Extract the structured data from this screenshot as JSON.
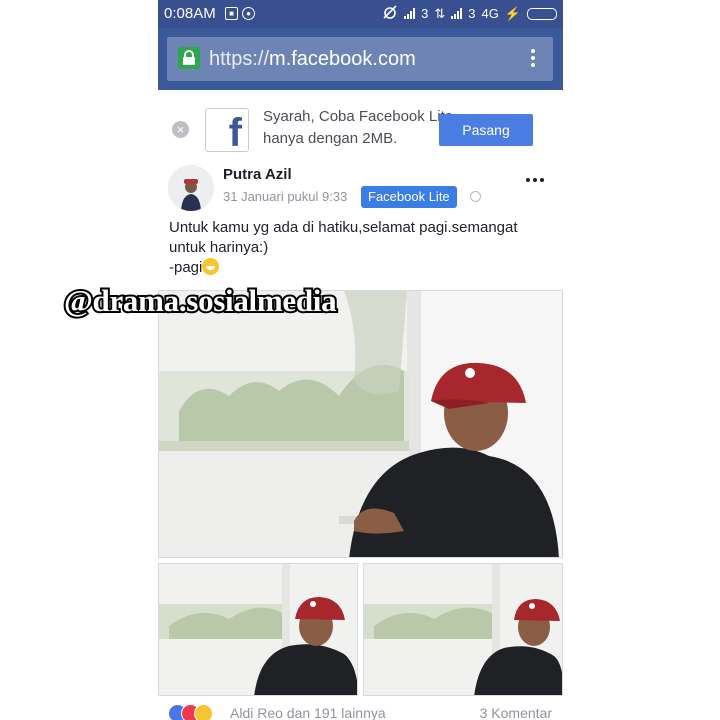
{
  "status_bar": {
    "time": "0:08AM",
    "network_label_1": "3",
    "network_label_2": "3",
    "network_type": "4G"
  },
  "browser": {
    "url_scheme": "https://",
    "url_host": "m.facebook.com"
  },
  "lite_banner": {
    "text": "Syarah, Coba Facebook Lite hanya dengan 2MB.",
    "install_label": "Pasang",
    "close_glyph": "×",
    "logo_letter": "f"
  },
  "post": {
    "author": "Putra Azil",
    "date": "31 Januari pukul 9:33",
    "via_badge": "Facebook Lite",
    "text_line1": "Untuk kamu yg ada di hatiku,selamat pagi.semangat",
    "text_line2": "untuk harinya:)",
    "text_line3": "-pagi",
    "emoji": "grinning-face"
  },
  "reactions": {
    "names": "Aldi Reo dan 191 lainnya",
    "comments": "3 Komentar",
    "icons": [
      "like-icon",
      "love-icon",
      "haha-icon"
    ],
    "colors": {
      "like": "#4a76e8",
      "love": "#f0394f",
      "haha": "#f7c533"
    }
  },
  "watermark": {
    "text": "@drama.sosialmedia"
  },
  "colors": {
    "status_bar": "#38508f",
    "url_bar_bg": "#3b5998",
    "url_field": "#6d84b4",
    "button_blue": "#4a7ee2",
    "secure_lock": "#2ba84a"
  }
}
